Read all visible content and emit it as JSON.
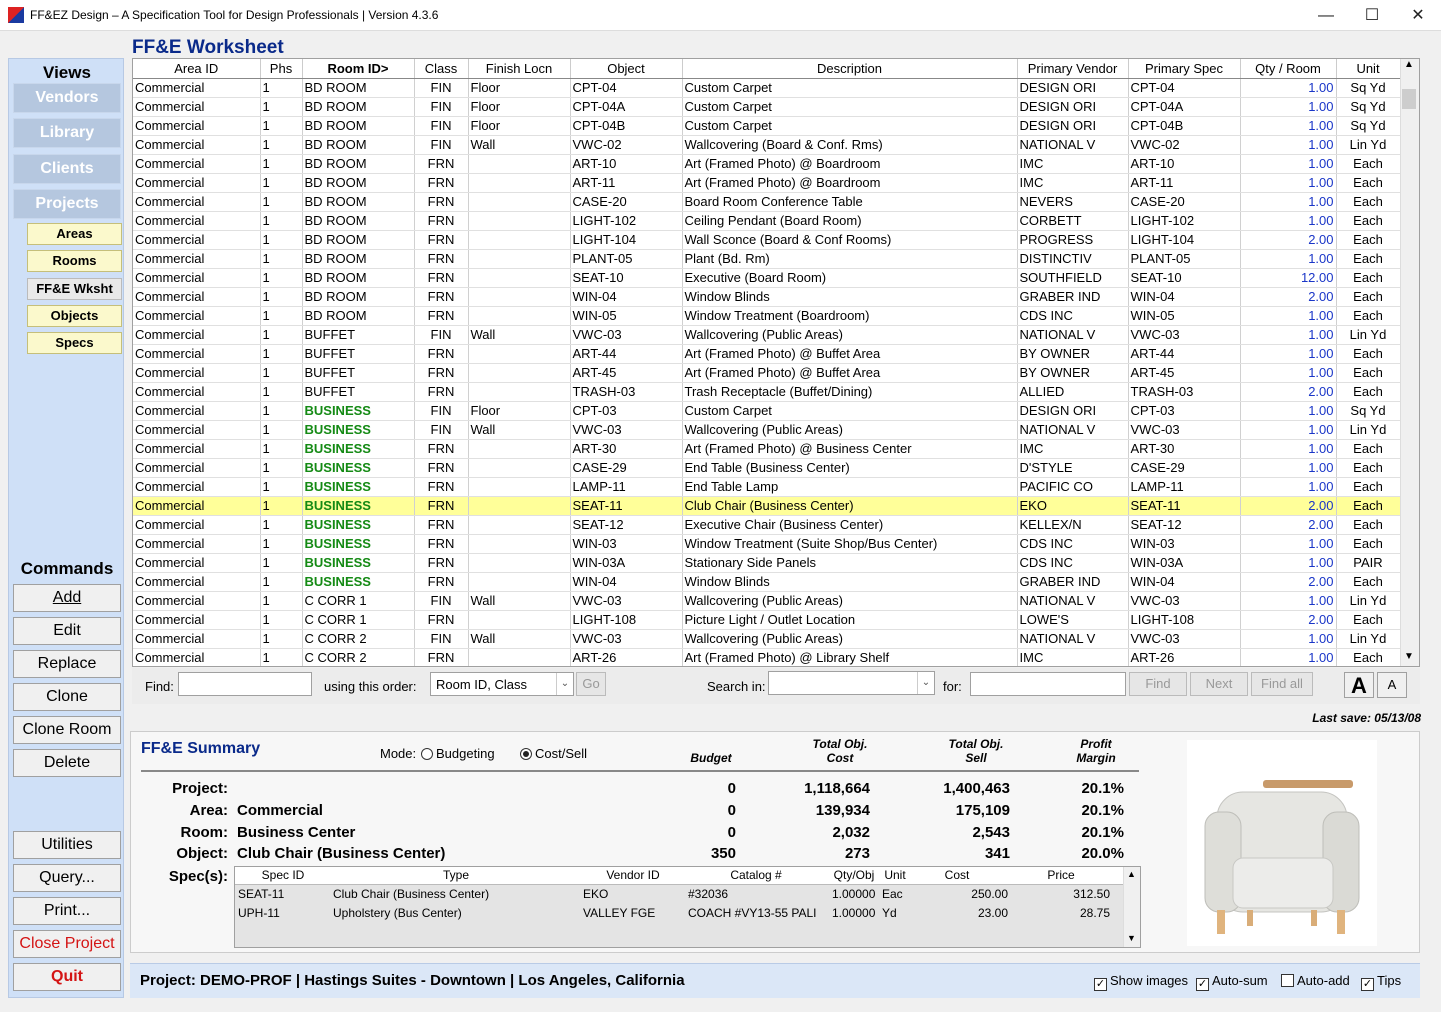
{
  "window": {
    "title": "FF&EZ Design – A Specification Tool for Design Professionals | Version 4.3.6"
  },
  "sidebar": {
    "views_label": "Views",
    "views": [
      "Vendors",
      "Library",
      "Clients",
      "Projects"
    ],
    "subviews": [
      {
        "label": "Areas"
      },
      {
        "label": "Rooms"
      },
      {
        "label": "FF&E Wksht",
        "active": true
      },
      {
        "label": "Objects"
      },
      {
        "label": "Specs"
      }
    ],
    "commands_label": "Commands",
    "commands": [
      "Add",
      "Edit",
      "Replace",
      "Clone",
      "Clone Room",
      "Delete"
    ],
    "utilities": [
      "Utilities",
      "Query...",
      "Print..."
    ],
    "close_project": "Close Project",
    "quit": "Quit"
  },
  "worksheet": {
    "title": "FF&E Worksheet",
    "columns": [
      "Area ID",
      "Phs",
      "Room ID>",
      "Class",
      "Finish Locn",
      "Object",
      "Description",
      "Primary Vendor",
      "Primary Spec",
      "Qty / Room",
      "Unit"
    ],
    "selected_row": 22,
    "rows": [
      [
        "Commercial",
        "1",
        "BD ROOM",
        "FIN",
        "Floor",
        "CPT-04",
        "Custom Carpet",
        "DESIGN ORI",
        "CPT-04",
        "1.00",
        "Sq Yd"
      ],
      [
        "Commercial",
        "1",
        "BD ROOM",
        "FIN",
        "Floor",
        "CPT-04A",
        "Custom Carpet",
        "DESIGN ORI",
        "CPT-04A",
        "1.00",
        "Sq Yd"
      ],
      [
        "Commercial",
        "1",
        "BD ROOM",
        "FIN",
        "Floor",
        "CPT-04B",
        "Custom Carpet",
        "DESIGN ORI",
        "CPT-04B",
        "1.00",
        "Sq Yd"
      ],
      [
        "Commercial",
        "1",
        "BD ROOM",
        "FIN",
        "Wall",
        "VWC-02",
        "Wallcovering (Board & Conf. Rms)",
        "NATIONAL V",
        "VWC-02",
        "1.00",
        "Lin Yd"
      ],
      [
        "Commercial",
        "1",
        "BD ROOM",
        "FRN",
        "",
        "ART-10",
        "Art  (Framed Photo) @ Boardroom",
        "IMC",
        "ART-10",
        "1.00",
        "Each"
      ],
      [
        "Commercial",
        "1",
        "BD ROOM",
        "FRN",
        "",
        "ART-11",
        "Art  (Framed Photo) @ Boardroom",
        "IMC",
        "ART-11",
        "1.00",
        "Each"
      ],
      [
        "Commercial",
        "1",
        "BD ROOM",
        "FRN",
        "",
        "CASE-20",
        "Board Room Conference Table",
        "NEVERS",
        "CASE-20",
        "1.00",
        "Each"
      ],
      [
        "Commercial",
        "1",
        "BD ROOM",
        "FRN",
        "",
        "LIGHT-102",
        "Ceiling Pendant (Board Room)",
        "CORBETT",
        "LIGHT-102",
        "1.00",
        "Each"
      ],
      [
        "Commercial",
        "1",
        "BD ROOM",
        "FRN",
        "",
        "LIGHT-104",
        "Wall Sconce (Board & Conf Rooms)",
        "PROGRESS",
        "LIGHT-104",
        "2.00",
        "Each"
      ],
      [
        "Commercial",
        "1",
        "BD ROOM",
        "FRN",
        "",
        "PLANT-05",
        "Plant (Bd. Rm)",
        "DISTINCTIV",
        "PLANT-05",
        "1.00",
        "Each"
      ],
      [
        "Commercial",
        "1",
        "BD ROOM",
        "FRN",
        "",
        "SEAT-10",
        "Executive  (Board Room)",
        "SOUTHFIELD",
        "SEAT-10",
        "12.00",
        "Each"
      ],
      [
        "Commercial",
        "1",
        "BD ROOM",
        "FRN",
        "",
        "WIN-04",
        "Window Blinds",
        "GRABER IND",
        "WIN-04",
        "2.00",
        "Each"
      ],
      [
        "Commercial",
        "1",
        "BD ROOM",
        "FRN",
        "",
        "WIN-05",
        "Window Treatment (Boardroom)",
        "CDS INC",
        "WIN-05",
        "1.00",
        "Each"
      ],
      [
        "Commercial",
        "1",
        "BUFFET",
        "FIN",
        "Wall",
        "VWC-03",
        "Wallcovering (Public Areas)",
        "NATIONAL V",
        "VWC-03",
        "1.00",
        "Lin Yd"
      ],
      [
        "Commercial",
        "1",
        "BUFFET",
        "FRN",
        "",
        "ART-44",
        "Art (Framed Photo) @  Buffet Area",
        "BY OWNER",
        "ART-44",
        "1.00",
        "Each"
      ],
      [
        "Commercial",
        "1",
        "BUFFET",
        "FRN",
        "",
        "ART-45",
        "Art (Framed Photo) @  Buffet Area",
        "BY OWNER",
        "ART-45",
        "1.00",
        "Each"
      ],
      [
        "Commercial",
        "1",
        "BUFFET",
        "FRN",
        "",
        "TRASH-03",
        "Trash Receptacle (Buffet/Dining)",
        "ALLIED",
        "TRASH-03",
        "2.00",
        "Each"
      ],
      [
        "Commercial",
        "1",
        "BUSINESS",
        "FIN",
        "Floor",
        "CPT-03",
        "Custom Carpet",
        "DESIGN ORI",
        "CPT-03",
        "1.00",
        "Sq Yd"
      ],
      [
        "Commercial",
        "1",
        "BUSINESS",
        "FIN",
        "Wall",
        "VWC-03",
        "Wallcovering (Public Areas)",
        "NATIONAL V",
        "VWC-03",
        "1.00",
        "Lin Yd"
      ],
      [
        "Commercial",
        "1",
        "BUSINESS",
        "FRN",
        "",
        "ART-30",
        "Art (Framed Photo) @ Business Center",
        "IMC",
        "ART-30",
        "1.00",
        "Each"
      ],
      [
        "Commercial",
        "1",
        "BUSINESS",
        "FRN",
        "",
        "CASE-29",
        "End Table (Business Center)",
        "D'STYLE",
        "CASE-29",
        "1.00",
        "Each"
      ],
      [
        "Commercial",
        "1",
        "BUSINESS",
        "FRN",
        "",
        "LAMP-11",
        "End Table Lamp",
        "PACIFIC CO",
        "LAMP-11",
        "1.00",
        "Each"
      ],
      [
        "Commercial",
        "1",
        "BUSINESS",
        "FRN",
        "",
        "SEAT-11",
        "Club Chair (Business Center)",
        "EKO",
        "SEAT-11",
        "2.00",
        "Each"
      ],
      [
        "Commercial",
        "1",
        "BUSINESS",
        "FRN",
        "",
        "SEAT-12",
        "Executive Chair (Business Center)",
        "KELLEX/N",
        "SEAT-12",
        "2.00",
        "Each"
      ],
      [
        "Commercial",
        "1",
        "BUSINESS",
        "FRN",
        "",
        "WIN-03",
        "Window Treatment (Suite Shop/Bus Center)",
        "CDS INC",
        "WIN-03",
        "1.00",
        "Each"
      ],
      [
        "Commercial",
        "1",
        "BUSINESS",
        "FRN",
        "",
        "WIN-03A",
        "Stationary Side Panels",
        "CDS INC",
        "WIN-03A",
        "1.00",
        "PAIR"
      ],
      [
        "Commercial",
        "1",
        "BUSINESS",
        "FRN",
        "",
        "WIN-04",
        "Window Blinds",
        "GRABER IND",
        "WIN-04",
        "2.00",
        "Each"
      ],
      [
        "Commercial",
        "1",
        "C CORR 1",
        "FIN",
        "Wall",
        "VWC-03",
        "Wallcovering (Public Areas)",
        "NATIONAL V",
        "VWC-03",
        "1.00",
        "Lin Yd"
      ],
      [
        "Commercial",
        "1",
        "C CORR 1",
        "FRN",
        "",
        "LIGHT-108",
        "Picture Light / Outlet Location",
        "LOWE'S",
        "LIGHT-108",
        "2.00",
        "Each"
      ],
      [
        "Commercial",
        "1",
        "C CORR 2",
        "FIN",
        "Wall",
        "VWC-03",
        "Wallcovering (Public Areas)",
        "NATIONAL V",
        "VWC-03",
        "1.00",
        "Lin Yd"
      ],
      [
        "Commercial",
        "1",
        "C CORR 2",
        "FRN",
        "",
        "ART-26",
        "Art (Framed Photo) @ Library Shelf",
        "IMC",
        "ART-26",
        "1.00",
        "Each"
      ]
    ]
  },
  "search": {
    "find_label": "Find:",
    "order_label": "using this order:",
    "order_value": "Room ID, Class",
    "go": "Go",
    "search_in_label": "Search in:",
    "for_label": "for:",
    "find_btn": "Find",
    "next_btn": "Next",
    "findall_btn": "Find all",
    "font_big": "A",
    "font_small": "A"
  },
  "last_save": "Last save: 05/13/08",
  "summary": {
    "title": "FF&E Summary",
    "mode_label": "Mode:",
    "mode_budgeting": "Budgeting",
    "mode_costsell": "Cost/Sell",
    "col_budget": "Budget",
    "col_cost": "Total Obj. Cost",
    "col_sell": "Total Obj. Sell",
    "col_margin": "Profit Margin",
    "rows": [
      {
        "label": "Project:",
        "name": "",
        "budget": "0",
        "cost": "1,118,664",
        "sell": "1,400,463",
        "margin": "20.1%"
      },
      {
        "label": "Area:",
        "name": "Commercial",
        "budget": "0",
        "cost": "139,934",
        "sell": "175,109",
        "margin": "20.1%"
      },
      {
        "label": "Room:",
        "name": "Business Center",
        "budget": "0",
        "cost": "2,032",
        "sell": "2,543",
        "margin": "20.1%"
      },
      {
        "label": "Object:",
        "name": "Club Chair (Business Center)",
        "budget": "350",
        "cost": "273",
        "sell": "341",
        "margin": "20.0%"
      }
    ],
    "specs_label": "Spec(s):",
    "spec_columns": [
      "Spec ID",
      "Type",
      "Vendor ID",
      "Catalog #",
      "Qty/Obj",
      "Unit",
      "Cost",
      "Price"
    ],
    "specs": [
      [
        "SEAT-11",
        "Club Chair (Business Center)",
        "EKO",
        "#32036",
        "1.00000",
        "Eac",
        "250.00",
        "312.50"
      ],
      [
        "UPH-11",
        "Upholstery (Bus Center)",
        "VALLEY FGE",
        "COACH #VY13-55 PALI",
        "1.00000",
        "Yd",
        "23.00",
        "28.75"
      ]
    ]
  },
  "status": {
    "text": "Project:  DEMO-PROF  |  Hastings Suites - Downtown  |  Los Angeles, California",
    "show_images": "Show images",
    "auto_sum": "Auto-sum",
    "auto_add": "Auto-add",
    "tips": "Tips"
  }
}
